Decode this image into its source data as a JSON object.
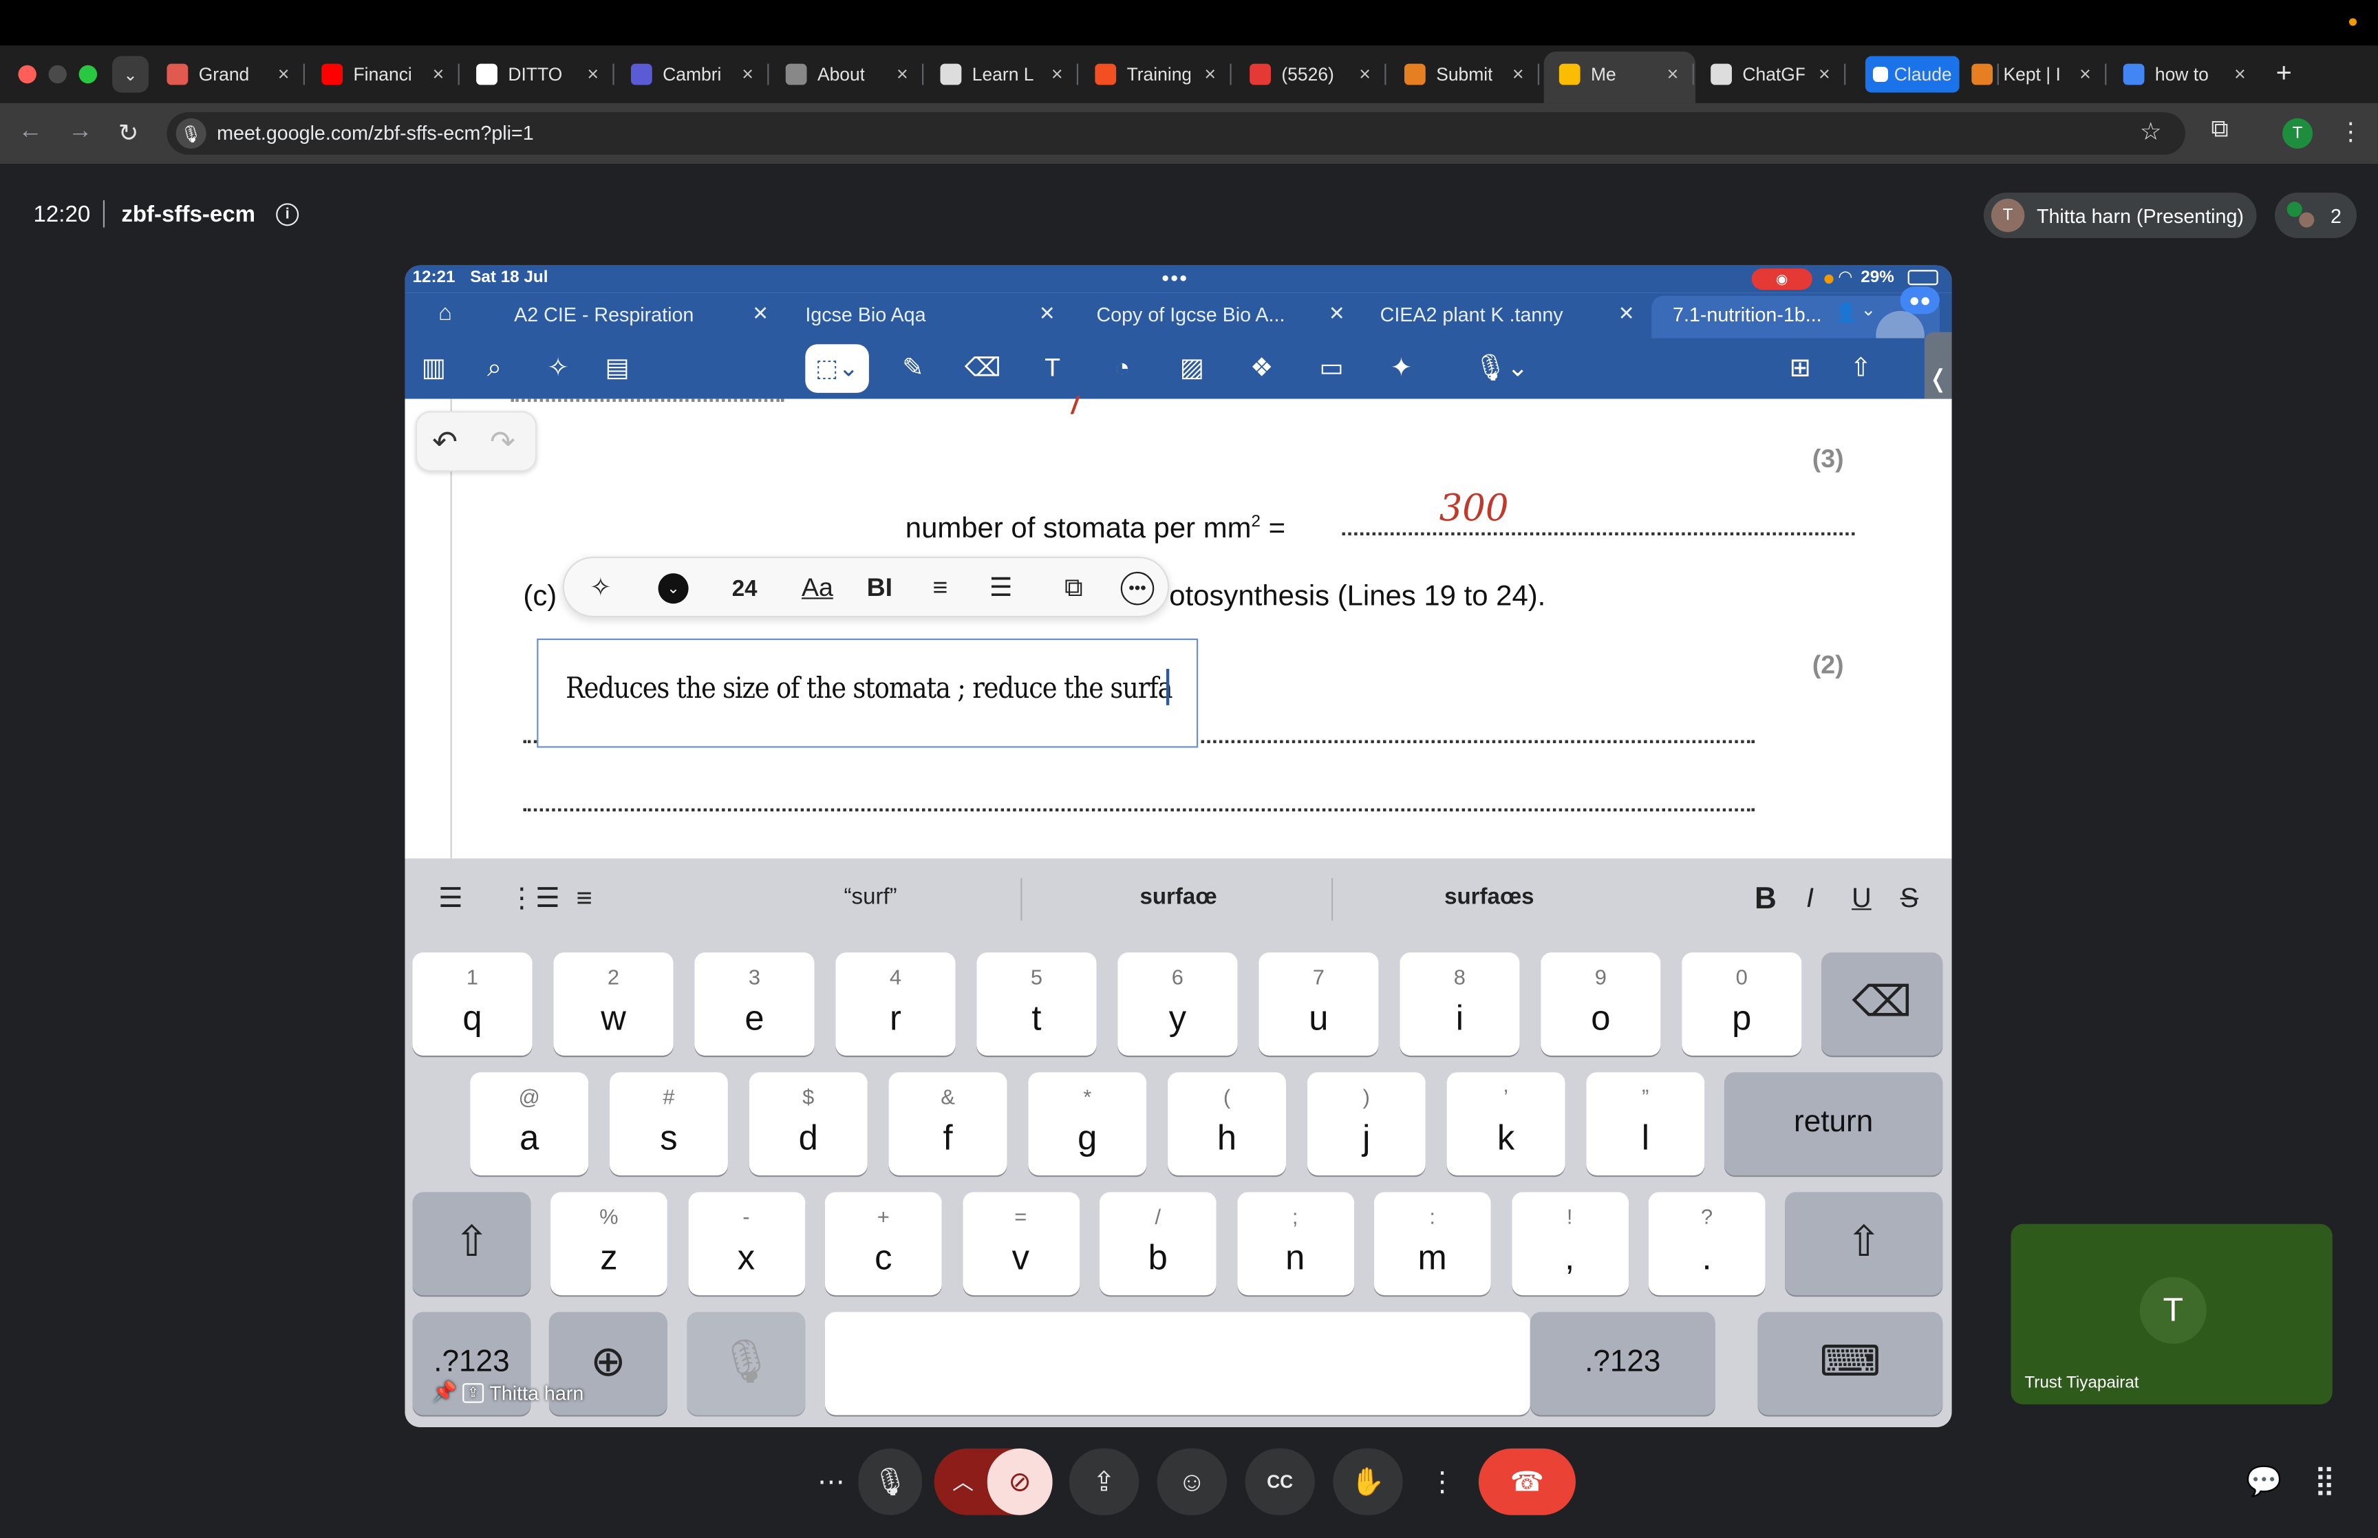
{
  "browser": {
    "tabs": [
      {
        "label": "Grand",
        "icon": "notebook-icon",
        "color": "#e05a4f"
      },
      {
        "label": "Financi",
        "icon": "youtube-icon",
        "color": "#ff0000"
      },
      {
        "label": "DITTO",
        "icon": "ditto-icon",
        "color": "#ffffff"
      },
      {
        "label": "Cambri",
        "icon": "bolt-icon",
        "color": "#5b5bd6"
      },
      {
        "label": "About",
        "icon": "globe-icon",
        "color": "#888888"
      },
      {
        "label": "Learn L",
        "icon": "openai-icon",
        "color": "#dddddd"
      },
      {
        "label": "Training",
        "icon": "microsoft-icon",
        "color": "#f25022"
      },
      {
        "label": "(5526)",
        "icon": "5k-icon",
        "color": "#e53935"
      },
      {
        "label": "Submit",
        "icon": "claude-orange-icon",
        "color": "#e67e22"
      },
      {
        "label": "Me",
        "icon": "meet-icon",
        "color": "#fbbc04"
      },
      {
        "label": "ChatGF",
        "icon": "chatgpt-icon",
        "color": "#dddddd"
      },
      {
        "label": "Claude",
        "icon": "check-icon",
        "color": "#1a73e8"
      },
      {
        "label": "Kept | I",
        "icon": "claude-orange-icon",
        "color": "#e67e22"
      },
      {
        "label": "how to",
        "icon": "google-icon",
        "color": "#4285f4"
      }
    ],
    "url": "meet.google.com/zbf-sffs-ecm?pli=1",
    "profile_initial": "T"
  },
  "meet": {
    "time": "12:20",
    "meeting_code": "zbf-sffs-ecm",
    "presenter_initial": "T",
    "presenter_label": "Thitta harn (Presenting)",
    "participants_count": "2",
    "self_initial": "T",
    "self_name": "Trust Tiyapairat",
    "pinned_label": "Thitta harn"
  },
  "ipad": {
    "status_time": "12:21",
    "status_date": "Sat 18 Jul",
    "battery": "29%",
    "doc_tabs": [
      "A2 CIE - Respiration",
      "Igcse Bio Aqa",
      "Copy of Igcse Bio A...",
      "CIEA2 plant K .tanny",
      "7.1-nutrition-1b..."
    ],
    "document": {
      "mark_3": "(3)",
      "stomata_label": "number of stomata per mm",
      "stomata_sup": "2",
      "stomata_eq": " =",
      "stomata_answer": "300",
      "part_c": "(c)",
      "question_tail": "otosynthesis (Lines 19 to 24).",
      "mark_2": "(2)",
      "handwritten": "Reduces the size of the stomata ; reduce the surfa"
    },
    "format_toolbar": {
      "font_size": "24",
      "font_label": "Aa",
      "bold_italic": "BI"
    },
    "keyboard": {
      "suggestions": [
        "“surf”",
        "surfaœ",
        "surfaœs"
      ],
      "row1": [
        {
          "sup": "1",
          "key": "q"
        },
        {
          "sup": "2",
          "key": "w"
        },
        {
          "sup": "3",
          "key": "e"
        },
        {
          "sup": "4",
          "key": "r"
        },
        {
          "sup": "5",
          "key": "t"
        },
        {
          "sup": "6",
          "key": "y"
        },
        {
          "sup": "7",
          "key": "u"
        },
        {
          "sup": "8",
          "key": "i"
        },
        {
          "sup": "9",
          "key": "o"
        },
        {
          "sup": "0",
          "key": "p"
        }
      ],
      "row2": [
        {
          "sup": "@",
          "key": "a"
        },
        {
          "sup": "#",
          "key": "s"
        },
        {
          "sup": "$",
          "key": "d"
        },
        {
          "sup": "&",
          "key": "f"
        },
        {
          "sup": "*",
          "key": "g"
        },
        {
          "sup": "(",
          "key": "h"
        },
        {
          "sup": ")",
          "key": "j"
        },
        {
          "sup": "’",
          "key": "k"
        },
        {
          "sup": "”",
          "key": "l"
        }
      ],
      "row3": [
        {
          "sup": "%",
          "key": "z"
        },
        {
          "sup": "-",
          "key": "x"
        },
        {
          "sup": "+",
          "key": "c"
        },
        {
          "sup": "=",
          "key": "v"
        },
        {
          "sup": "/",
          "key": "b"
        },
        {
          "sup": ";",
          "key": "n"
        },
        {
          "sup": ":",
          "key": "m"
        },
        {
          "sup": "!",
          "key": ","
        },
        {
          "sup": "?",
          "key": "."
        }
      ],
      "return_label": "return",
      "numbers_label": ".?123"
    }
  },
  "colors": {
    "accent_blue": "#2c5aa0",
    "end_call_red": "#ea4335",
    "annotation_red": "#c0392b"
  }
}
